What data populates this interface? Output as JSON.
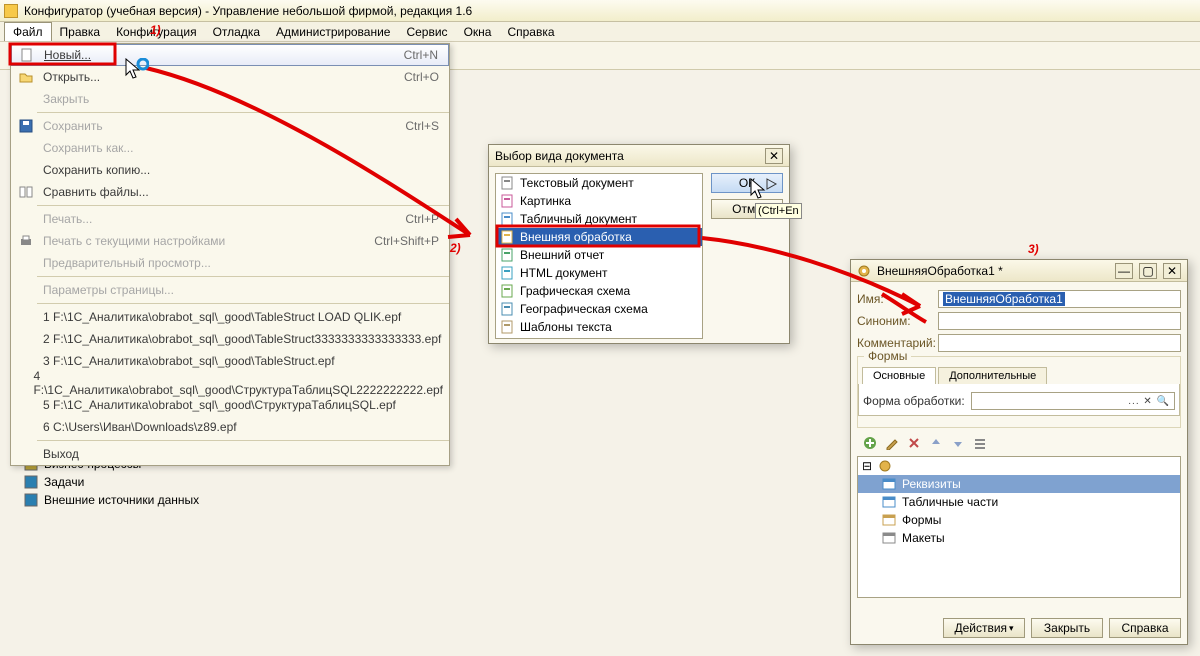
{
  "title": "Конфигуратор (учебная версия) - Управление небольшой фирмой, редакция 1.6",
  "menubar": [
    "Файл",
    "Правка",
    "Конфигурация",
    "Отладка",
    "Администрирование",
    "Сервис",
    "Окна",
    "Справка"
  ],
  "file_menu": {
    "items": [
      {
        "label": "Новый...",
        "shortcut": "Ctrl+N",
        "icon": "new",
        "hl": true
      },
      {
        "label": "Открыть...",
        "shortcut": "Ctrl+O",
        "icon": "open"
      },
      {
        "label": "Закрыть",
        "shortcut": "",
        "dim": true
      },
      {
        "sep": true
      },
      {
        "label": "Сохранить",
        "shortcut": "Ctrl+S",
        "icon": "save",
        "dim": true
      },
      {
        "label": "Сохранить как...",
        "shortcut": "",
        "dim": true
      },
      {
        "label": "Сохранить копию...",
        "shortcut": ""
      },
      {
        "label": "Сравнить файлы...",
        "shortcut": "",
        "icon": "compare"
      },
      {
        "sep": true
      },
      {
        "label": "Печать...",
        "shortcut": "Ctrl+P",
        "dim": true
      },
      {
        "label": "Печать с текущими настройками",
        "shortcut": "Ctrl+Shift+P",
        "icon": "print",
        "dim": true
      },
      {
        "label": "Предварительный просмотр...",
        "shortcut": "",
        "dim": true
      },
      {
        "sep": true
      },
      {
        "label": "Параметры страницы...",
        "shortcut": "",
        "dim": true
      },
      {
        "sep": true
      },
      {
        "label": "1 F:\\1C_Аналитика\\obrabot_sql\\_good\\TableStruct LOAD QLIK.epf"
      },
      {
        "label": "2 F:\\1C_Аналитика\\obrabot_sql\\_good\\TableStruct3333333333333333.epf"
      },
      {
        "label": "3 F:\\1C_Аналитика\\obrabot_sql\\_good\\TableStruct.epf"
      },
      {
        "label": "4 F:\\1C_Аналитика\\obrabot_sql\\_good\\СтруктураТаблицSQL2222222222.epf"
      },
      {
        "label": "5 F:\\1C_Аналитика\\obrabot_sql\\_good\\СтруктураТаблицSQL.epf"
      },
      {
        "label": "6 C:\\Users\\Иван\\Downloads\\z89.epf"
      },
      {
        "sep": true
      },
      {
        "label": "Выход"
      }
    ]
  },
  "tree": {
    "items": [
      {
        "label": "Бизнес-процессы",
        "color": "#b9a23a"
      },
      {
        "label": "Задачи",
        "color": "#2a7fb0"
      },
      {
        "label": "Внешние источники данных",
        "color": "#2a7fb0"
      }
    ]
  },
  "doc_dialog": {
    "title": "Выбор вида документа",
    "ok": "ОК",
    "cancel": "Отме",
    "tooltip": "(Ctrl+En",
    "items": [
      {
        "label": "Текстовый документ",
        "icon": "text"
      },
      {
        "label": "Картинка",
        "icon": "image"
      },
      {
        "label": "Табличный документ",
        "icon": "table"
      },
      {
        "label": "Внешняя обработка",
        "icon": "ext",
        "sel": true
      },
      {
        "label": "Внешний отчет",
        "icon": "report"
      },
      {
        "label": "HTML документ",
        "icon": "html"
      },
      {
        "label": "Графическая схема",
        "icon": "graph"
      },
      {
        "label": "Географическая схема",
        "icon": "geo"
      },
      {
        "label": "Шаблоны текста",
        "icon": "templ"
      }
    ]
  },
  "prop_dialog": {
    "title": "ВнешняяОбработка1 *",
    "name_label": "Имя:",
    "name_value": "ВнешняяОбработка1",
    "syn_label": "Синоним:",
    "comment_label": "Комментарий:",
    "group_forms": "Формы",
    "tab_main": "Основные",
    "tab_extra": "Дополнительные",
    "form_label": "Форма обработки:",
    "tree": [
      {
        "label": "Реквизиты",
        "sel": true,
        "icon": "attrs"
      },
      {
        "label": "Табличные части",
        "icon": "tab"
      },
      {
        "label": "Формы",
        "icon": "forms"
      },
      {
        "label": "Макеты",
        "icon": "layouts"
      }
    ],
    "actions": "Действия",
    "close": "Закрыть",
    "help": "Справка"
  },
  "annotations": {
    "a1": "1)",
    "a2": "2)",
    "a3": "3)"
  }
}
